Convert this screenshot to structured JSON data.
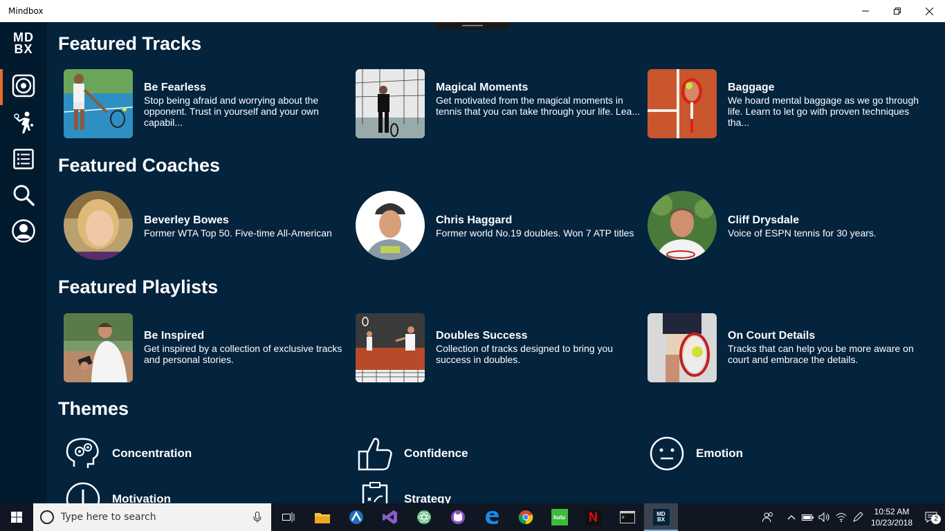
{
  "window": {
    "title": "Mindbox"
  },
  "logo": {
    "line1": "MD",
    "line2": "BX"
  },
  "sidebar": {
    "items": [
      {
        "name": "home",
        "icon": "speaker-disc-icon",
        "active": true
      },
      {
        "name": "players",
        "icon": "tennis-player-icon"
      },
      {
        "name": "list",
        "icon": "list-icon"
      },
      {
        "name": "search",
        "icon": "search-icon"
      },
      {
        "name": "profile",
        "icon": "user-icon"
      }
    ]
  },
  "sections": {
    "tracks": "Featured Tracks",
    "coaches": "Featured Coaches",
    "playlists": "Featured Playlists",
    "themes": "Themes"
  },
  "tracks": [
    {
      "title": "Be Fearless",
      "desc": "Stop being afraid and worrying about the opponent. Trust in yourself and your own capabil..."
    },
    {
      "title": "Magical Moments",
      "desc": "Get motivated from the magical moments in tennis that you can take through your life. Lea..."
    },
    {
      "title": "Baggage",
      "desc": "We hoard mental baggage as we go through life. Learn to let go with proven techniques tha..."
    }
  ],
  "coaches": [
    {
      "name": "Beverley Bowes",
      "desc": "Former WTA Top 50. Five-time All-American"
    },
    {
      "name": "Chris Haggard",
      "desc": "Former world No.19 doubles. Won 7 ATP titles"
    },
    {
      "name": "Cliff Drysdale",
      "desc": "Voice of ESPN tennis for 30 years."
    }
  ],
  "playlists": [
    {
      "title": "Be Inspired",
      "desc": "Get inspired by a collection of exclusive tracks and personal stories."
    },
    {
      "title": "Doubles Success",
      "desc": "Collection of tracks designed to bring you success in doubles."
    },
    {
      "title": "On Court Details",
      "desc": "Tracks that can help you be more aware on court and embrace the details."
    }
  ],
  "themes": [
    {
      "label": "Concentration",
      "icon": "brain-gears-icon"
    },
    {
      "label": "Confidence",
      "icon": "thumbs-up-icon"
    },
    {
      "label": "Emotion",
      "icon": "neutral-face-icon"
    },
    {
      "label": "Motivation",
      "icon": "exclamation-icon"
    },
    {
      "label": "Strategy",
      "icon": "clipboard-strategy-icon"
    }
  ],
  "taskbar": {
    "search_placeholder": "Type here to search",
    "time": "10:52 AM",
    "date": "10/23/2018",
    "notifications": "2",
    "apps": [
      "task-view",
      "file-explorer",
      "browser-app",
      "visual-studio",
      "atom",
      "cat-app",
      "edge",
      "chrome",
      "hulu",
      "netflix",
      "terminal",
      "mindbox"
    ],
    "hulu_label": "hulu",
    "netflix_label": "N",
    "mindbox_label": "MD BX"
  },
  "colors": {
    "background": "#04233d",
    "sidebar": "#021a2e",
    "accent": "#e56c2b"
  }
}
